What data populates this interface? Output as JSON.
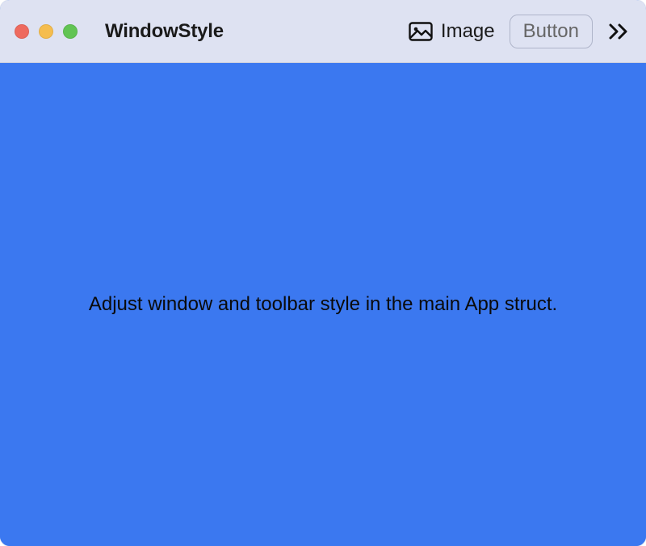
{
  "window": {
    "title": "WindowStyle"
  },
  "toolbar": {
    "image_item_label": "Image",
    "button_label": "Button"
  },
  "content": {
    "body_text": "Adjust window and toolbar style in the main App struct."
  }
}
